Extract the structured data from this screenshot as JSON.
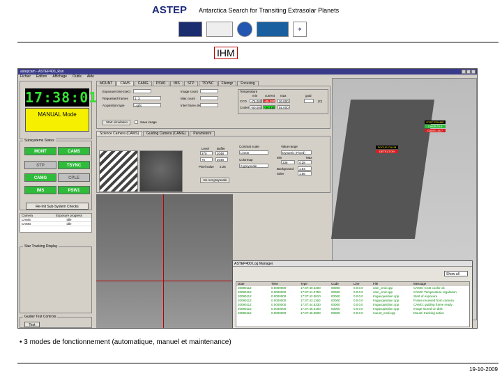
{
  "header": {
    "title": "ASTEP",
    "subtitle": "Antarctica Search for Transiting Extrasolar Planets",
    "logos": [
      "cassiopée-logo",
      "fizeau-logo",
      "ohp-logo",
      "oca-logo",
      "dlr-logo"
    ]
  },
  "section_title": "IHM",
  "app": {
    "window_title": "astepcam - ASTEP400_Run",
    "menu": [
      "Fichier",
      "Edition",
      "Affichage",
      "Outils",
      "Aide"
    ],
    "clock": "17:38:01",
    "mode": "MANUAL Mode",
    "subsystems_label": "Subsystems Status",
    "subsystems": [
      {
        "label": "MONT",
        "color": "green"
      },
      {
        "label": "CAMS",
        "color": "green"
      },
      {
        "label": "STP",
        "color": "grey"
      },
      {
        "label": "TSYNC",
        "color": "green"
      },
      {
        "label": "CAMG",
        "color": "green"
      },
      {
        "label": "CPLE",
        "color": "grey"
      },
      {
        "label": "IMS",
        "color": "green"
      },
      {
        "label": "PSW1",
        "color": "green"
      }
    ],
    "reinit_button": "Re-Init Sub-System Checks",
    "camera_table": {
      "headers": [
        "Camera",
        "Exposure progress"
      ],
      "rows": [
        [
          "CAMS",
          "idle"
        ],
        [
          "CAMG",
          "idle"
        ]
      ]
    },
    "star_tracking_label": "Star Tracking Display",
    "guide_test_label": "Guider Test Controls",
    "guide_test_button": "Test",
    "top_tabs": [
      "MOUNT",
      "CAMS",
      "CAMG",
      "PSW1",
      "IMS",
      "STP",
      "TSYNC",
      "Filemgr",
      "Focusing"
    ],
    "exposure": {
      "exp_time_label": "Exposure time (sec)",
      "frames_label": "Requested frames",
      "acq_type_label": "Acquisition type",
      "img_count_label": "Image count",
      "max_count_label": "Max count",
      "delay_label": "Inter frame delay (sec)",
      "frame_value": "1, 3",
      "acq_value": "Light",
      "start_sim_button": "Start simulation",
      "save_image_label": "Save image"
    },
    "temperature": {
      "label": "Temperature",
      "cols": [
        "min",
        "current",
        "max",
        "goal"
      ],
      "rows": [
        {
          "name": "CCD",
          "min": "-75.000",
          "current": "-85.290",
          "max": "30.000"
        },
        {
          "name": "Cooler",
          "min": "-60.000",
          "current": "-34.510",
          "max": "55.000"
        }
      ],
      "reset": "(C)"
    },
    "sub_tabs": [
      "Science Camera (CAMS)",
      "Guiding Camera (CAMG)",
      "Parameters"
    ],
    "display": {
      "level_label": "Level",
      "buffer_label": "Buffer",
      "level1": "370",
      "buffer1": "2048",
      "level2": "75",
      "buffer2": "2048",
      "pixel_label": "Pixel value",
      "pixel_value": "2.25",
      "grayscale_button": "Do not grayscale",
      "contrast_label": "Contrast scale",
      "contrast_value": "Linear",
      "colormap_label": "Colormap",
      "colormap_value": "0-greyscale",
      "value_range_label": "Value range",
      "value_range_value": "Dynamic (Fixed)",
      "min_label": "Min",
      "max_label": "Max",
      "min_value": "338",
      "max_value": "4.28",
      "bg_label": "Background",
      "bg_value": "1.84",
      "sd_label": "Sdev",
      "sd_value": "1.56"
    },
    "telescope_tags": [
      "STEP FRAME",
      "CAMS:23.4",
      "CAMG:-44.7",
      "FOCUS CALIB",
      "DETECTOR"
    ],
    "log": {
      "title": "ASTEP400 Log Manager",
      "show_all": "Show all",
      "headers": [
        "Date",
        "Time",
        "Type",
        "Code",
        "Line",
        "File",
        "Message"
      ],
      "rows": [
        [
          "20090112",
          "0.0000000",
          "17:37:40.2200",
          "00000",
          "0.0.0.0",
          "cam_cmd.cpp",
          "CAMS: CCD cooler ok"
        ],
        [
          "20090112",
          "0.0000000",
          "17:37:41.0750",
          "00000",
          "0.0.0.0",
          "cam_cmd.cpp",
          "CAMS: Temperature regulation"
        ],
        [
          "20090112",
          "0.0000000",
          "17:37:42.0810",
          "00000",
          "0.0.0.0",
          "Imgacquisition.cpp",
          "Start of exposure"
        ],
        [
          "20090112",
          "0.0000000",
          "17:37:43.1150",
          "00000",
          "0.0.0.0",
          "Imgacquisition.cpp",
          "Frame received from camera"
        ],
        [
          "20090112",
          "0.0000000",
          "17:37:44.5230",
          "00000",
          "0.0.0.0",
          "Imgacquisition.cpp",
          "CAMG: guiding frame ready"
        ],
        [
          "20090112",
          "0.0000000",
          "17:37:45.0100",
          "00000",
          "0.0.0.0",
          "Imgacquisition.cpp",
          "Image stored on disk"
        ],
        [
          "20090112",
          "0.0000000",
          "17:37:46.0500",
          "00000",
          "0.0.0.0",
          "mount_cmd.cpp",
          "Mount: tracking active"
        ]
      ]
    }
  },
  "bullet": "3 modes de fonctionnement (automatique, manuel et maintenance)",
  "date": "19-10-2009"
}
